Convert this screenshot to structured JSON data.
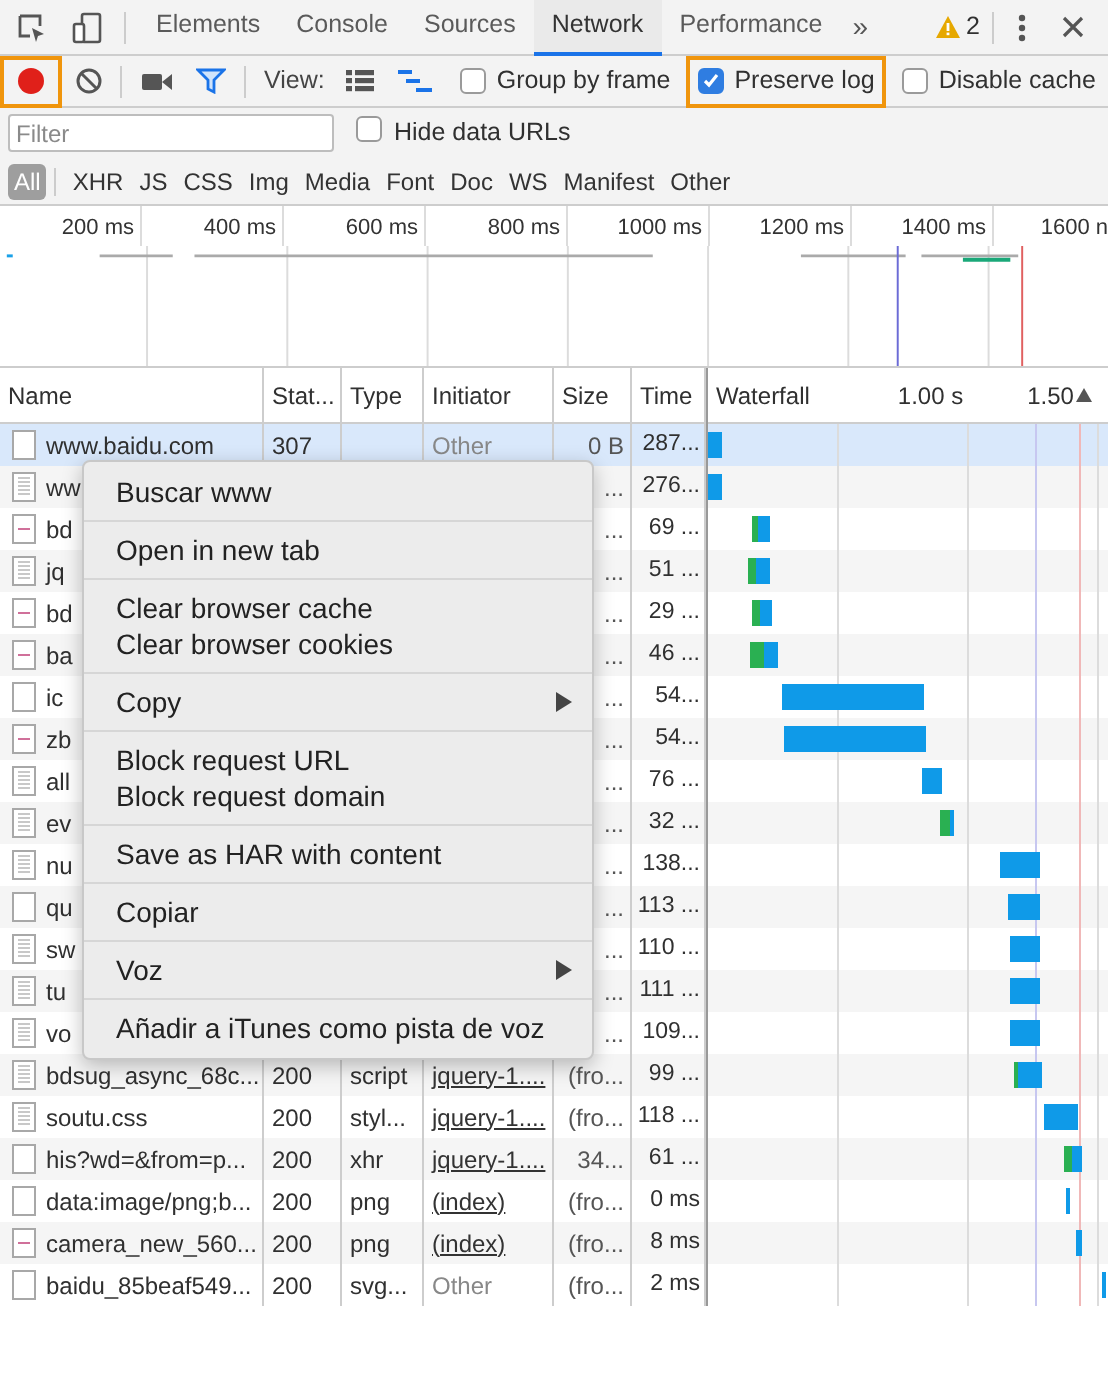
{
  "tabs": [
    {
      "label": "Elements",
      "selected": false
    },
    {
      "label": "Console",
      "selected": false
    },
    {
      "label": "Sources",
      "selected": false
    },
    {
      "label": "Network",
      "selected": true
    },
    {
      "label": "Performance",
      "selected": false
    }
  ],
  "more_tabs": "»",
  "warnings": "2",
  "toolbar": {
    "recording": true,
    "record_highlighted": true,
    "filter_active": true,
    "view_label": "View:",
    "large_rows": false,
    "overview": true,
    "checkboxes": [
      {
        "label": "Group by frame",
        "checked": false,
        "highlighted": false
      },
      {
        "label": "Preserve log",
        "checked": true,
        "highlighted": true
      },
      {
        "label": "Disable cache",
        "checked": false,
        "highlighted": false
      }
    ]
  },
  "filter": {
    "placeholder": "Filter",
    "hide_data_urls": {
      "label": "Hide data URLs",
      "checked": false
    }
  },
  "type_filters": [
    {
      "label": "All",
      "selected": true
    },
    {
      "label": "XHR",
      "selected": false
    },
    {
      "label": "JS",
      "selected": false
    },
    {
      "label": "CSS",
      "selected": false
    },
    {
      "label": "Img",
      "selected": false
    },
    {
      "label": "Media",
      "selected": false
    },
    {
      "label": "Font",
      "selected": false
    },
    {
      "label": "Doc",
      "selected": false
    },
    {
      "label": "WS",
      "selected": false
    },
    {
      "label": "Manifest",
      "selected": false
    },
    {
      "label": "Other",
      "selected": false
    }
  ],
  "overview_ticks": [
    "200 ms",
    "400 ms",
    "600 ms",
    "800 ms",
    "1000 ms",
    "1200 ms",
    "1400 ms",
    "1600 n"
  ],
  "table": {
    "columns": [
      "Name",
      "Stat...",
      "Type",
      "Initiator",
      "Size",
      "Time",
      "Waterfall"
    ],
    "waterfall_ticks": [
      "1.00 s",
      "1.50"
    ],
    "rows": [
      {
        "kind": "blank",
        "name": "www.baidu.com",
        "status": "307",
        "type": "",
        "initiator": "Other",
        "initiator_link": false,
        "size": "0 B",
        "time": "287...",
        "selected": true
      },
      {
        "kind": "document",
        "name": "ww",
        "status": "",
        "type": "",
        "initiator": "",
        "size": "...",
        "time": "276...",
        "selected": false
      },
      {
        "kind": "image",
        "name": "bd",
        "status": "",
        "type": "",
        "initiator": "",
        "size": "...",
        "time": "69 ...",
        "selected": false
      },
      {
        "kind": "document",
        "name": "jq",
        "status": "",
        "type": "",
        "initiator": "",
        "size": "...",
        "time": "51 ...",
        "selected": false
      },
      {
        "kind": "image",
        "name": "bd",
        "status": "",
        "type": "",
        "initiator": "",
        "size": "...",
        "time": "29 ...",
        "selected": false
      },
      {
        "kind": "image",
        "name": "ba",
        "status": "",
        "type": "",
        "initiator": "",
        "size": "...",
        "time": "46 ...",
        "selected": false
      },
      {
        "kind": "blank",
        "name": "ic",
        "status": "",
        "type": "",
        "initiator": "",
        "size": "...",
        "time": "54...",
        "selected": false
      },
      {
        "kind": "image",
        "name": "zb",
        "status": "",
        "type": "",
        "initiator": "",
        "size": "...",
        "time": "54...",
        "selected": false
      },
      {
        "kind": "document",
        "name": "all",
        "status": "",
        "type": "",
        "initiator": "",
        "size": "...",
        "time": "76 ...",
        "selected": false
      },
      {
        "kind": "document",
        "name": "ev",
        "status": "",
        "type": "",
        "initiator": "",
        "size": "...",
        "time": "32 ...",
        "selected": false
      },
      {
        "kind": "document",
        "name": "nu",
        "status": "",
        "type": "",
        "initiator": "",
        "size": "...",
        "time": "138...",
        "selected": false
      },
      {
        "kind": "blank",
        "name": "qu",
        "status": "",
        "type": "",
        "initiator": "",
        "size": "...",
        "time": "113 ...",
        "selected": false
      },
      {
        "kind": "document",
        "name": "sw",
        "status": "",
        "type": "",
        "initiator": "",
        "size": "...",
        "time": "110 ...",
        "selected": false
      },
      {
        "kind": "document",
        "name": "tu",
        "status": "",
        "type": "",
        "initiator": "",
        "size": "...",
        "time": "111 ...",
        "selected": false
      },
      {
        "kind": "document",
        "name": "vo",
        "status": "",
        "type": "",
        "initiator": "",
        "size": "...",
        "time": "109...",
        "selected": false
      },
      {
        "kind": "document",
        "name": "bdsug_async_68c...",
        "status": "200",
        "type": "script",
        "initiator": "jquery-1....",
        "initiator_link": true,
        "size": "(fro...",
        "time": "99 ...",
        "selected": false
      },
      {
        "kind": "document",
        "name": "soutu.css",
        "status": "200",
        "type": "styl...",
        "initiator": "jquery-1....",
        "initiator_link": true,
        "size": "(fro...",
        "time": "118 ...",
        "selected": false
      },
      {
        "kind": "blank",
        "name": "his?wd=&from=p...",
        "status": "200",
        "type": "xhr",
        "initiator": "jquery-1....",
        "initiator_link": true,
        "size": "34...",
        "time": "61 ...",
        "selected": false
      },
      {
        "kind": "blank",
        "name": "data:image/png;b...",
        "status": "200",
        "type": "png",
        "initiator": "(index)",
        "initiator_link": true,
        "size": "(fro...",
        "time": "0 ms",
        "selected": false
      },
      {
        "kind": "image",
        "name": "camera_new_560...",
        "status": "200",
        "type": "png",
        "initiator": "(index)",
        "initiator_link": true,
        "size": "(fro...",
        "time": "8 ms",
        "selected": false
      },
      {
        "kind": "blank",
        "name": "baidu_85beaf549...",
        "status": "200",
        "type": "svg...",
        "initiator": "Other",
        "initiator_link": false,
        "size": "(fro...",
        "time": "2 ms",
        "selected": false
      }
    ]
  },
  "context_menu": [
    [
      {
        "label": "Buscar www",
        "has_submenu": false
      }
    ],
    [
      {
        "label": "Open in new tab",
        "has_submenu": false
      }
    ],
    [
      {
        "label": "Clear browser cache",
        "has_submenu": false
      },
      {
        "label": "Clear browser cookies",
        "has_submenu": false
      }
    ],
    [
      {
        "label": "Copy",
        "has_submenu": true
      }
    ],
    [
      {
        "label": "Block request URL",
        "has_submenu": false
      },
      {
        "label": "Block request domain",
        "has_submenu": false
      }
    ],
    [
      {
        "label": "Save as HAR with content",
        "has_submenu": false
      }
    ],
    [
      {
        "label": "Copiar",
        "has_submenu": false
      }
    ],
    [
      {
        "label": "Voz",
        "has_submenu": true
      }
    ],
    [
      {
        "label": "Añadir a iTunes como pista de voz",
        "has_submenu": false
      }
    ]
  ]
}
